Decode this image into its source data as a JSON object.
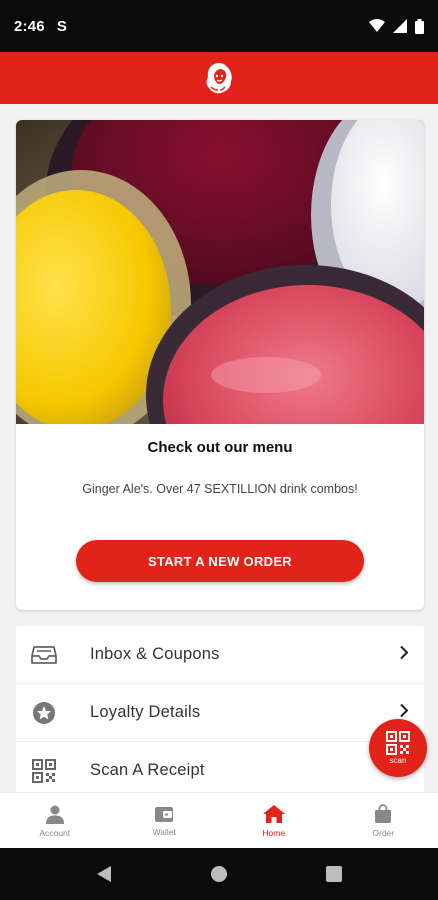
{
  "status": {
    "time": "2:46",
    "carrier_glyph": "S"
  },
  "brand": {
    "logo": "wendys-girl-logo",
    "accent": "#e2231a"
  },
  "promo": {
    "title": "Check out our menu",
    "subtitle": "Ginger Ale's. Over 47 SEXTILLION drink combos!",
    "cta_label": "START A NEW ORDER"
  },
  "menu": {
    "items": [
      {
        "label": "Inbox & Coupons",
        "icon": "inbox-icon"
      },
      {
        "label": "Loyalty Details",
        "icon": "star-badge-icon"
      },
      {
        "label": "Scan A Receipt",
        "icon": "qr-code-icon"
      }
    ]
  },
  "scan_fab": {
    "label": "scan"
  },
  "bottom_nav": {
    "tabs": [
      {
        "label": "Account",
        "icon": "person-icon"
      },
      {
        "label": "Wallet",
        "icon": "wallet-icon"
      },
      {
        "label": "Home",
        "icon": "home-icon",
        "active": true
      },
      {
        "label": "Order",
        "icon": "shopping-bag-icon"
      }
    ]
  }
}
